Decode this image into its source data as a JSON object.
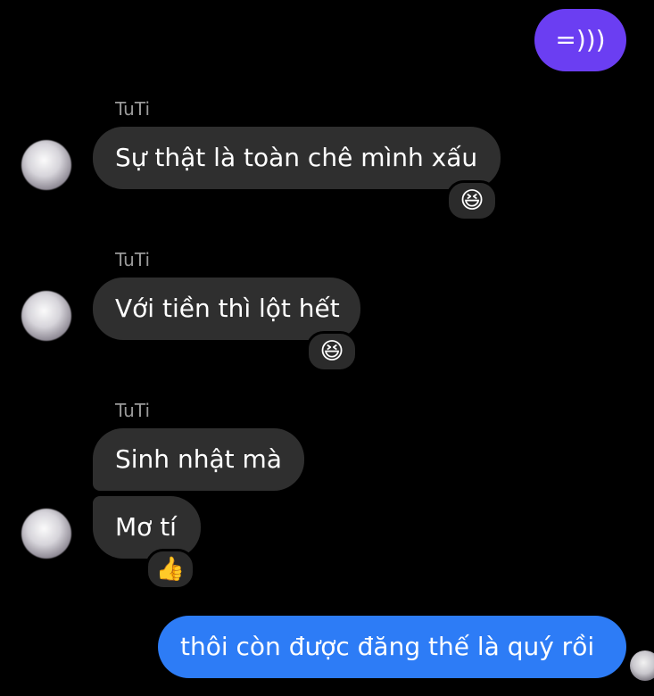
{
  "messages": {
    "m1": {
      "text": "=)))"
    },
    "m2": {
      "sender": "TuTi",
      "text": "Sự thật là toàn chê mình xấu",
      "reaction": "😆"
    },
    "m3": {
      "sender": "TuTi",
      "text": "Với tiền thì lột hết",
      "reaction": "😆"
    },
    "m4": {
      "sender": "TuTi",
      "text": "Sinh nhật mà"
    },
    "m5": {
      "text": "Mơ tí",
      "reaction": "👍"
    },
    "m6": {
      "text": "thôi còn được đăng thế là quý rồi"
    }
  },
  "colors": {
    "background": "#000000",
    "incoming_bubble": "#2f2f2f",
    "outgoing_purple": "#6b3ef2",
    "outgoing_blue": "#2d7cf6"
  }
}
